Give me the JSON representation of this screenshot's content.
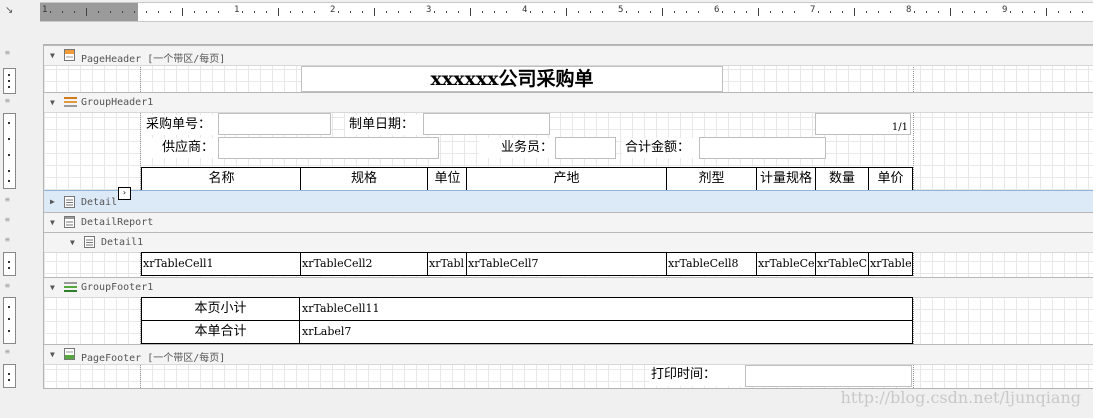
{
  "ruler": {
    "numbers": [
      "1",
      "1",
      "2",
      "3",
      "4",
      "5",
      "6",
      "7",
      "8",
      "9"
    ]
  },
  "bands": {
    "page_header": "PageHeader [一个带区/每页]",
    "group_header": "GroupHeader1",
    "detail": "Detail",
    "detail_report": "DetailReport",
    "detail1": "Detail1",
    "group_footer": "GroupFooter1",
    "page_footer": "PageFooter [一个带区/每页]"
  },
  "header": {
    "title": "xxxxxx公司采购单"
  },
  "fields": {
    "po_no_label": "采购单号：",
    "date_label": "制单日期：",
    "page_num": "1/1",
    "supplier_label": "供应商：",
    "salesman_label": "业务员：",
    "total_label": "合计金额："
  },
  "table_header": [
    "名称",
    "规格",
    "单位",
    "产地",
    "剂型",
    "计量规格",
    "数量",
    "单价"
  ],
  "detail_cells": [
    "xrTableCell1",
    "xrTableCell2",
    "xrTabl",
    "xrTableCell7",
    "xrTableCell8",
    "xrTableCe",
    "xrTableC",
    "xrTable"
  ],
  "footer_rows": {
    "page_subtotal_label": "本页小计",
    "page_subtotal_value": "xrTableCell11",
    "order_total_label": "本单合计",
    "order_total_value": "xrLabel7"
  },
  "page_footer": {
    "print_time_label": "打印时间："
  },
  "watermark": "http://blog.csdn.net/ljunqiang",
  "icons": {
    "expanded": "triangle-down-icon",
    "collapsed": "triangle-right-icon",
    "page_header": "page-header-icon",
    "group_header": "group-header-icon",
    "detail": "detail-icon",
    "detail_report": "detail-report-icon",
    "group_footer": "group-footer-icon",
    "page_footer": "page-footer-icon",
    "smart_tag": "smart-tag-icon"
  }
}
